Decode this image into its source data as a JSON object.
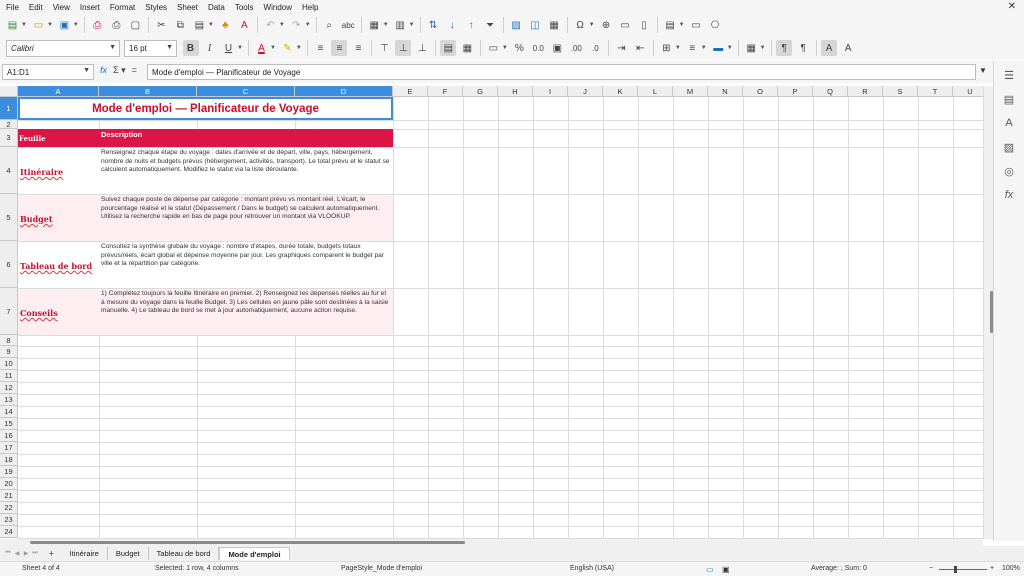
{
  "menu": [
    "File",
    "Edit",
    "View",
    "Insert",
    "Format",
    "Styles",
    "Sheet",
    "Data",
    "Tools",
    "Window",
    "Help"
  ],
  "toolbar": {
    "font_name": "Calibri",
    "font_size": "16 pt"
  },
  "formula_bar": {
    "name_box": "A1:D1",
    "content": "Mode d'emploi — Planificateur de Voyage"
  },
  "columns": [
    "A",
    "B",
    "C",
    "D",
    "E",
    "F",
    "G",
    "H",
    "I",
    "J",
    "K",
    "L",
    "M",
    "N",
    "O",
    "P",
    "Q",
    "R",
    "S",
    "T",
    "U"
  ],
  "rows": [
    "1",
    "2",
    "3",
    "4",
    "5",
    "6",
    "7",
    "8",
    "9",
    "10",
    "11",
    "12",
    "13",
    "14",
    "15",
    "16",
    "17",
    "18",
    "19",
    "20",
    "21",
    "22",
    "23",
    "24"
  ],
  "sheet": {
    "title": "Mode d'emploi — Planificateur de Voyage",
    "header_feuille": "Feuille",
    "header_description": "Description",
    "entries": [
      {
        "feuille": "Itinéraire",
        "description": "Renseignez chaque étape du voyage : dates d'arrivée et de départ, ville, pays, hébergement, nombre de nuits et budgets prévus (hébergement, activités, transport). Le total prévu et le statut se calculent automatiquement. Modifiez le statut via la liste déroulante."
      },
      {
        "feuille": "Budget",
        "description": "Suivez chaque poste de dépense par catégorie : montant prévu vs montant réel. L'écart, le pourcentage réalisé et le statut (Dépassement / Dans le budget) se calculent automatiquement. Utilisez la recherche rapide en bas de page pour retrouver un montant via VLOOKUP."
      },
      {
        "feuille": "Tableau de bord",
        "description": "Consultez la synthèse globale du voyage : nombre d'étapes, durée totale, budgets totaux prévus/réels, écart global et dépense moyenne par jour. Les graphiques comparent le budget par ville et la répartition par catégorie."
      },
      {
        "feuille": "Conseils",
        "description": "1) Complétez toujours la feuille Itinéraire en premier. 2) Renseignez les dépenses réelles au fur et à mesure du voyage dans la feuille Budget. 3) Les cellules en jaune pâle sont destinées à la saisie manuelle. 4) Le tableau de bord se met à jour automatiquement, aucune action requise."
      }
    ]
  },
  "sheet_tabs": [
    "Itinéraire",
    "Budget",
    "Tableau de bord",
    "Mode d'emploi"
  ],
  "status": {
    "sheet_pos": "Sheet 4 of 4",
    "selection": "Selected: 1 row, 4 columns",
    "page_style": "PageStyle_Mode d'emploi",
    "language": "English (USA)",
    "sum": "Average: ; Sum: 0",
    "zoom": "100%"
  },
  "colors": {
    "accent": "#dc1447",
    "selection": "#3c8dde",
    "title": "#c8102e"
  }
}
